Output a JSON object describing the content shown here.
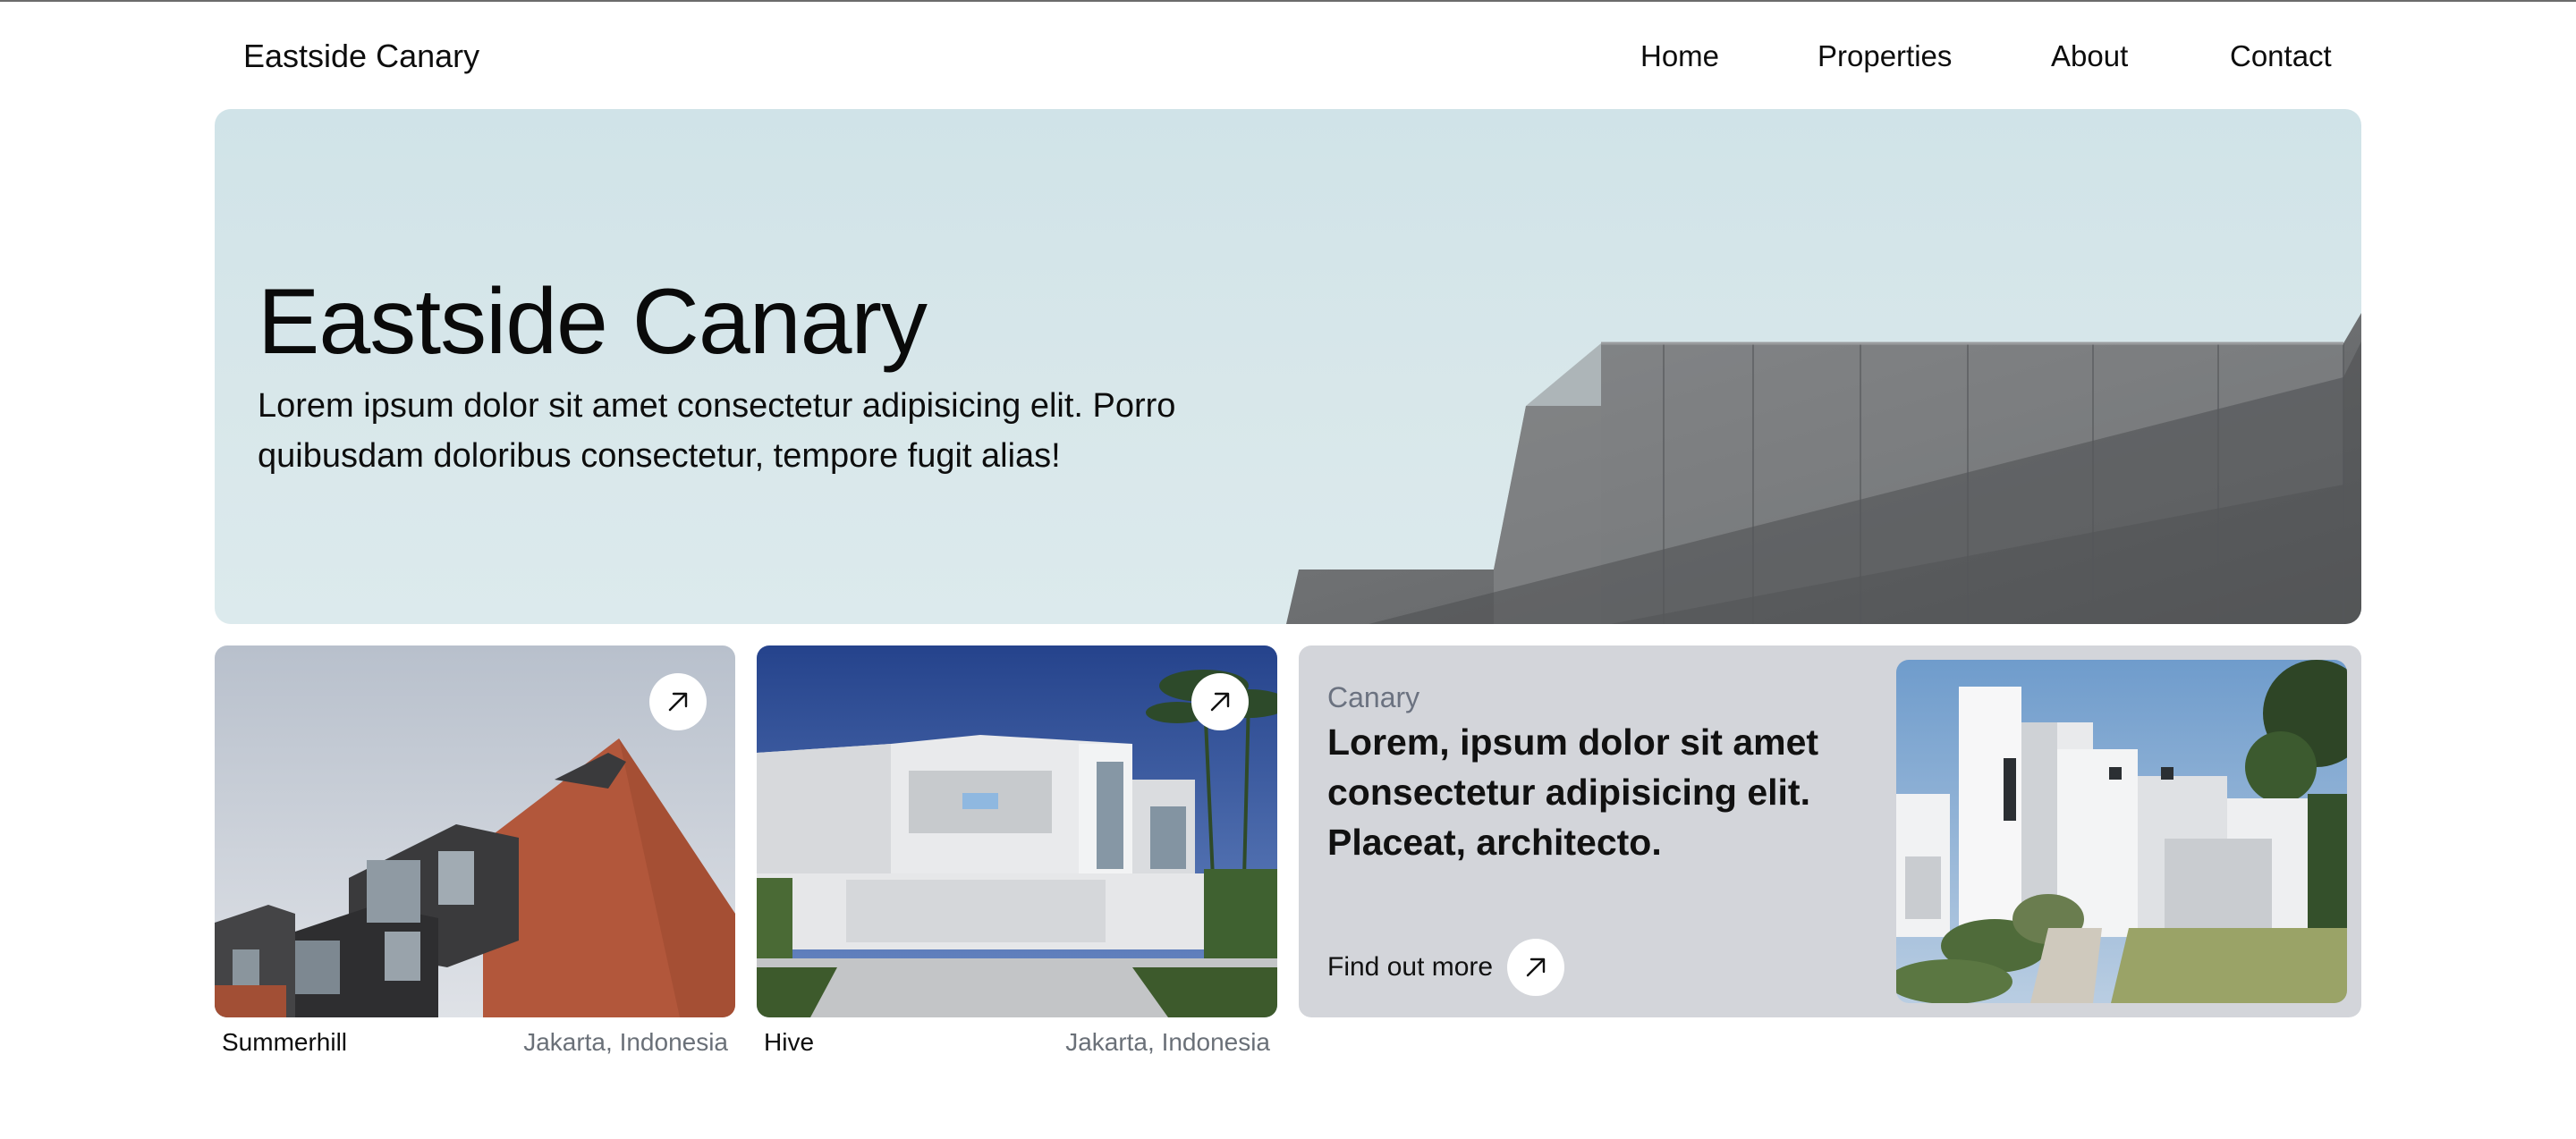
{
  "brand": "Eastside Canary",
  "nav": {
    "home": "Home",
    "properties": "Properties",
    "about": "About",
    "contact": "Contact"
  },
  "hero": {
    "title": "Eastside Canary",
    "subtitle": "Lorem ipsum dolor sit amet consectetur adipisicing elit. Porro quibusdam doloribus consectetur, tempore fugit alias!"
  },
  "properties": [
    {
      "name": "Summerhill",
      "location": "Jakarta, Indonesia",
      "icon": "arrow-up-right-icon"
    },
    {
      "name": "Hive",
      "location": "Jakarta, Indonesia",
      "icon": "arrow-up-right-icon"
    }
  ],
  "feature": {
    "eyebrow": "Canary",
    "headline": "Lorem, ipsum dolor sit amet consectetur adipisicing elit. Placeat, architecto.",
    "cta": "Find out more",
    "cta_icon": "arrow-up-right-icon"
  },
  "colors": {
    "hero_sky": "#d0e3e8",
    "concrete": "#6f7173",
    "feature_panel": "#d3d5da",
    "muted_text": "#6a7078"
  }
}
